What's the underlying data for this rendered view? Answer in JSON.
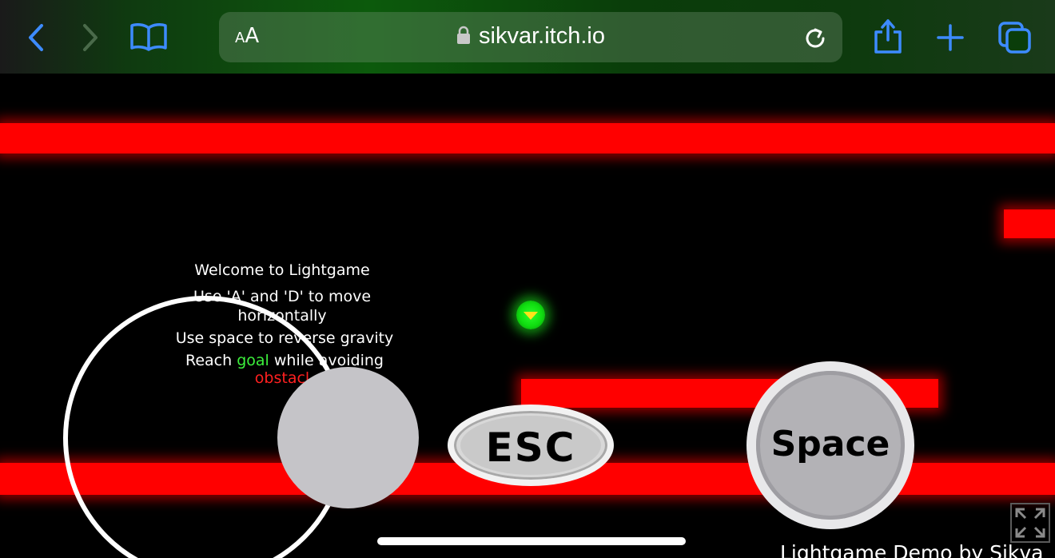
{
  "browser": {
    "url": "sikvar.itch.io",
    "reader_label_small": "A",
    "reader_label_big": "A",
    "icons": [
      "back-icon",
      "forward-icon",
      "bookmarks-icon",
      "lock-icon",
      "reload-icon",
      "share-icon",
      "new-tab-icon",
      "tabs-icon"
    ],
    "accent": "#3d8bff"
  },
  "game": {
    "instructions": {
      "line1": "Welcome to Lightgame",
      "line2": "Use 'A' and 'D' to move",
      "line3": "horizontally",
      "line4": "Use space to reverse gravity",
      "line5_pre": "Reach",
      "line5_goal": "goal",
      "line5_post": "while avoiding",
      "line6": "obstacl"
    },
    "controls": {
      "esc_label": "ESC",
      "space_label": "Space"
    },
    "credit": "Lightgame Demo by Sikva",
    "colors": {
      "obstacle": "#ff0000",
      "player": "#1ee61e",
      "goal_text": "#3cf03c",
      "background": "#000000"
    },
    "icons": [
      "fullscreen-icon"
    ]
  }
}
